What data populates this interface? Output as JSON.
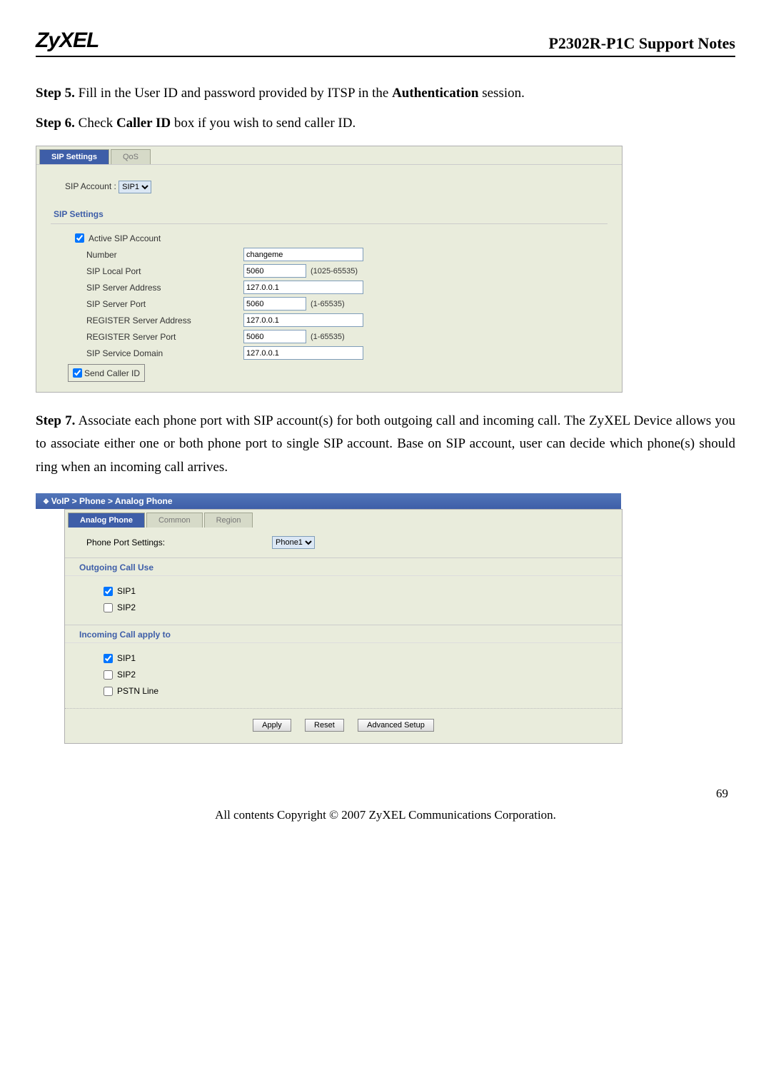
{
  "header": {
    "logo": "ZyXEL",
    "title": "P2302R-P1C Support Notes"
  },
  "step5": {
    "prefix": "Step 5.",
    "text_a": " Fill in the User ID and password provided by ITSP in the ",
    "bold": "Authentication",
    "text_b": " session."
  },
  "step6": {
    "prefix": "Step 6.",
    "text_a": " Check ",
    "bold": "Caller ID",
    "text_b": " box if you wish to send caller ID."
  },
  "sipPanel": {
    "tab_active": "SIP Settings",
    "tab_inactive": "QoS",
    "sip_account_label": "SIP Account :",
    "sip_account_value": "SIP1",
    "section_title": "SIP Settings",
    "active_sip_label": "Active SIP Account",
    "rows": {
      "number_label": "Number",
      "number_value": "changeme",
      "local_port_label": "SIP Local Port",
      "local_port_value": "5060",
      "local_port_hint": "(1025-65535)",
      "server_addr_label": "SIP Server Address",
      "server_addr_value": "127.0.0.1",
      "server_port_label": "SIP Server Port",
      "server_port_value": "5060",
      "server_port_hint": "(1-65535)",
      "reg_addr_label": "REGISTER Server Address",
      "reg_addr_value": "127.0.0.1",
      "reg_port_label": "REGISTER Server Port",
      "reg_port_value": "5060",
      "reg_port_hint": "(1-65535)",
      "svc_domain_label": "SIP Service Domain",
      "svc_domain_value": "127.0.0.1"
    },
    "send_caller_id_label": "Send Caller ID"
  },
  "step7": {
    "prefix": "Step 7.",
    "text": " Associate each phone port with SIP account(s) for both outgoing call and incoming call. The ZyXEL Device allows you to associate either one or both phone port to single SIP account.  Base on SIP account, user can decide which phone(s) should ring when an incoming call arrives."
  },
  "breadcrumb": "VoIP > Phone > Analog Phone",
  "phonePanel": {
    "tab_active": "Analog Phone",
    "tab2": "Common",
    "tab3": "Region",
    "phone_port_label": "Phone Port Settings:",
    "phone_port_value": "Phone1",
    "outgoing_title": "Outgoing Call Use",
    "incoming_title": "Incoming Call apply to",
    "sip1": "SIP1",
    "sip2": "SIP2",
    "pstn": "PSTN Line",
    "apply": "Apply",
    "reset": "Reset",
    "advanced": "Advanced Setup"
  },
  "page_number": "69",
  "footer": "All contents Copyright © 2007 ZyXEL Communications Corporation."
}
